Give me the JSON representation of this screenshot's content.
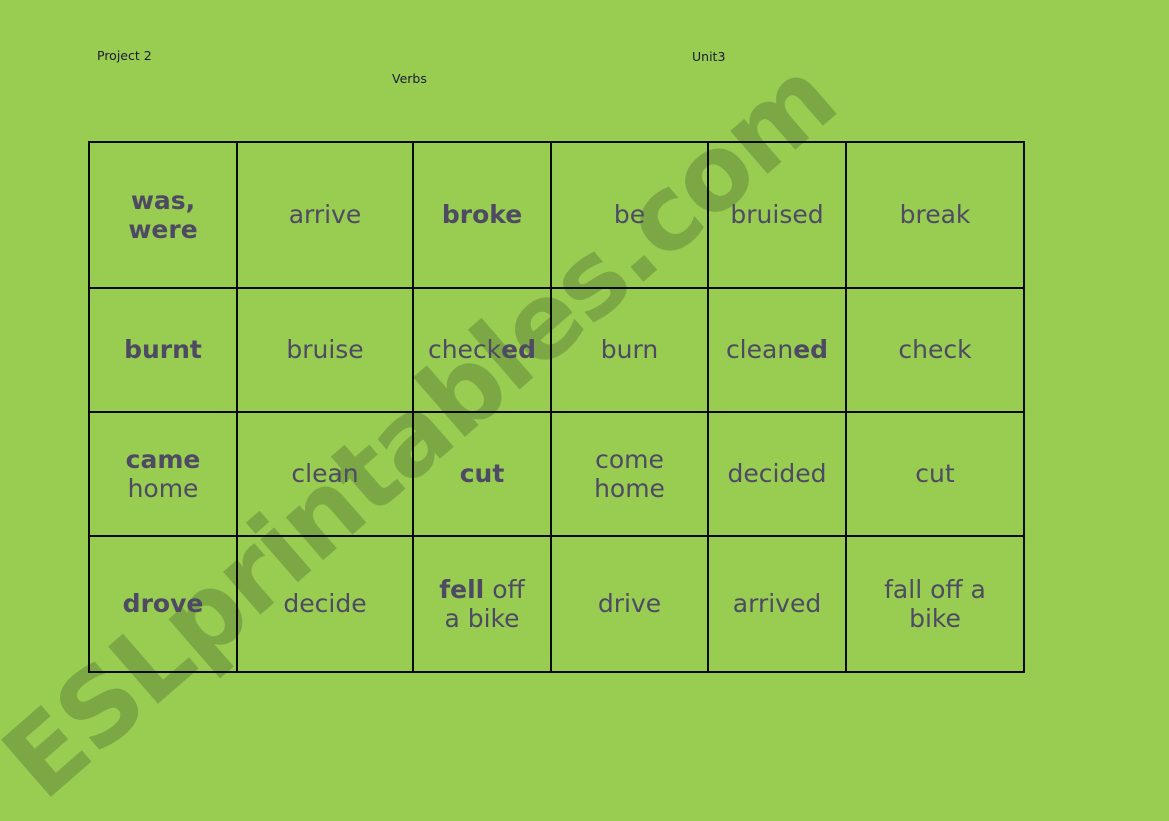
{
  "page": {
    "background_color": "#98cd51",
    "text_color": "#4e4a63",
    "border_color": "#0b0b0b",
    "watermark": "ESLprintables.com",
    "watermark_color": "#7ba844"
  },
  "header": {
    "project": "Project 2",
    "unit": "Unit3",
    "subject": "Verbs"
  },
  "table": {
    "columns": 6,
    "rows": 4,
    "cells": [
      [
        {
          "id": "r1c1",
          "bold": "was,",
          "regular": "",
          "line2_bold": "were",
          "line2_regular": "",
          "weight": "bold",
          "text": "was, were"
        },
        {
          "id": "r1c2",
          "weight": "regular",
          "text": "arrive"
        },
        {
          "id": "r1c3",
          "weight": "bold",
          "text": "broke"
        },
        {
          "id": "r1c4",
          "weight": "regular",
          "text": "be"
        },
        {
          "id": "r1c5",
          "weight": "regular",
          "text": "bruised"
        },
        {
          "id": "r1c6",
          "weight": "regular",
          "text": "break"
        }
      ],
      [
        {
          "id": "r2c1",
          "weight": "bold",
          "text": "burnt"
        },
        {
          "id": "r2c2",
          "weight": "regular",
          "text": "bruise"
        },
        {
          "id": "r2c3",
          "weight": "mixed",
          "text": "checked",
          "stem": "check",
          "suffix": "ed"
        },
        {
          "id": "r2c4",
          "weight": "regular",
          "text": "burn"
        },
        {
          "id": "r2c5",
          "weight": "mixed",
          "text": "cleaned",
          "stem": "clean",
          "suffix": "ed"
        },
        {
          "id": "r2c6",
          "weight": "regular",
          "text": "check"
        }
      ],
      [
        {
          "id": "r3c1",
          "weight": "mixed",
          "text": "came home",
          "line1": "came",
          "line2": "home"
        },
        {
          "id": "r3c2",
          "weight": "regular",
          "text": "clean"
        },
        {
          "id": "r3c3",
          "weight": "bold",
          "text": "cut"
        },
        {
          "id": "r3c4",
          "weight": "regular",
          "text": "come home",
          "line1": "come",
          "line2": "home"
        },
        {
          "id": "r3c5",
          "weight": "regular",
          "text": "decided"
        },
        {
          "id": "r3c6",
          "weight": "regular",
          "text": "cut"
        }
      ],
      [
        {
          "id": "r4c1",
          "weight": "bold",
          "text": "drove"
        },
        {
          "id": "r4c2",
          "weight": "regular",
          "text": "decide"
        },
        {
          "id": "r4c3",
          "weight": "mixed",
          "text": "fell off a bike",
          "line1_bold": "fell",
          "line1_regular": "off",
          "line2": "a bike"
        },
        {
          "id": "r4c4",
          "weight": "regular",
          "text": "drive"
        },
        {
          "id": "r4c5",
          "weight": "regular",
          "text": "arrived"
        },
        {
          "id": "r4c6",
          "weight": "regular",
          "text": "fall off a bike",
          "line1": "fall off a",
          "line2": "bike"
        }
      ]
    ]
  }
}
